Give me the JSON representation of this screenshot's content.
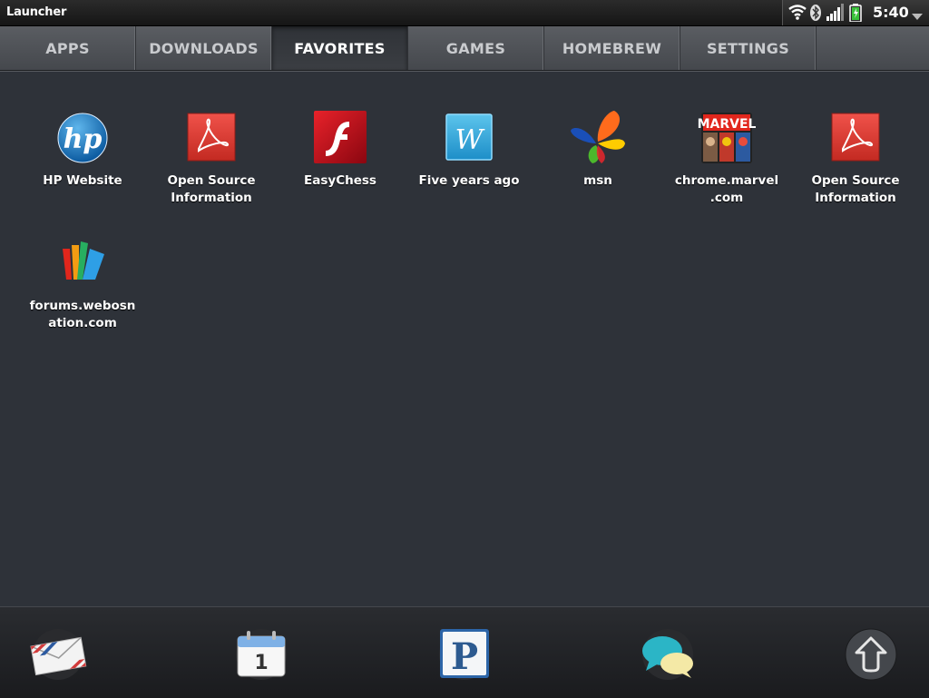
{
  "status_bar": {
    "app_title": "Launcher",
    "clock": "5:40",
    "icons": [
      "wifi-icon",
      "bluetooth-icon",
      "signal-icon",
      "battery-icon",
      "menu-arrow-icon"
    ]
  },
  "tabs": [
    {
      "label": "APPS",
      "active": false
    },
    {
      "label": "DOWNLOADS",
      "active": false
    },
    {
      "label": "FAVORITES",
      "active": true
    },
    {
      "label": "GAMES",
      "active": false
    },
    {
      "label": "HOMEBREW",
      "active": false
    },
    {
      "label": "SETTINGS",
      "active": false
    }
  ],
  "apps": [
    {
      "label": "HP Website",
      "icon": "hp-icon"
    },
    {
      "label": "Open Source Information",
      "icon": "pdf-icon"
    },
    {
      "label": "EasyChess",
      "icon": "flash-icon"
    },
    {
      "label": "Five years ago",
      "icon": "w-icon"
    },
    {
      "label": "msn",
      "icon": "msn-butterfly-icon"
    },
    {
      "label": "chrome.marvel .com",
      "icon": "marvel-icon"
    },
    {
      "label": "Open Source Information",
      "icon": "pdf-icon"
    },
    {
      "label": "forums.webosn ation.com",
      "icon": "webos-nation-icon"
    }
  ],
  "dock": [
    {
      "name": "email",
      "icon": "email-icon"
    },
    {
      "name": "calendar",
      "icon": "calendar-icon",
      "text": "1"
    },
    {
      "name": "pandora",
      "icon": "pandora-icon",
      "text": "P"
    },
    {
      "name": "messaging",
      "icon": "messaging-icon"
    },
    {
      "name": "launcher",
      "icon": "launcher-up-icon"
    }
  ],
  "colors": {
    "background": "#2e3239",
    "tab_bar": "#505358",
    "active_tab": "#34373c",
    "pdf_red": "#d8372f",
    "flash_red": "#c0101a"
  }
}
